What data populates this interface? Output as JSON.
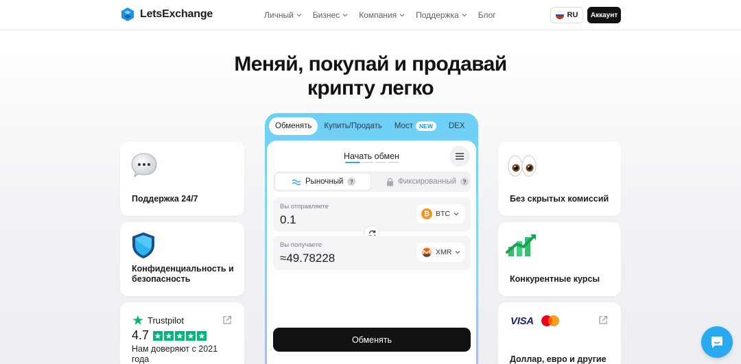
{
  "nav": {
    "logo_text": "LetsExchange",
    "menu": [
      {
        "label": "Личный",
        "has_dropdown": true
      },
      {
        "label": "Бизнес",
        "has_dropdown": true
      },
      {
        "label": "Компания",
        "has_dropdown": true
      },
      {
        "label": "Поддержка",
        "has_dropdown": true
      },
      {
        "label": "Блог",
        "has_dropdown": false
      }
    ],
    "lang": "RU",
    "account": "Аккаунт"
  },
  "hero": {
    "line1": "Меняй, покупай и продавай",
    "line2": "крипту легко"
  },
  "left_cards": {
    "support": "Поддержка 24/7",
    "privacy": "Конфиденциальность и безопасность",
    "trustpilot": {
      "brand": "Trustpilot",
      "rating": "4.7",
      "stars": 5,
      "text": "Нам доверяют с 2021 года"
    }
  },
  "right_cards": {
    "no_fees": "Без скрытых комиссий",
    "rates": "Конкурентные курсы",
    "payments": {
      "visa": "VISA",
      "text": "Доллар, евро и другие"
    }
  },
  "widget": {
    "tabs": [
      {
        "label": "Обменять",
        "active": true
      },
      {
        "label": "Купить/Продать",
        "active": false
      },
      {
        "label": "Мост",
        "active": false,
        "badge": "NEW"
      },
      {
        "label": "DEX",
        "active": false
      }
    ],
    "title": "Начать обмен",
    "modes": {
      "market": "Рыночный",
      "fixed": "Фиксированный",
      "help": "?"
    },
    "send": {
      "label": "Вы отправляете",
      "value": "0.1",
      "coin": "BTC"
    },
    "receive": {
      "label": "Вы получаете",
      "value": "≈49.78228",
      "coin": "XMR"
    },
    "button": "Обменять"
  },
  "colors": {
    "accent": "#29a9ef",
    "dark": "#111214",
    "trustpilot_green": "#00b67a",
    "btc": "#f7931a",
    "xmr": "#ff6600"
  }
}
